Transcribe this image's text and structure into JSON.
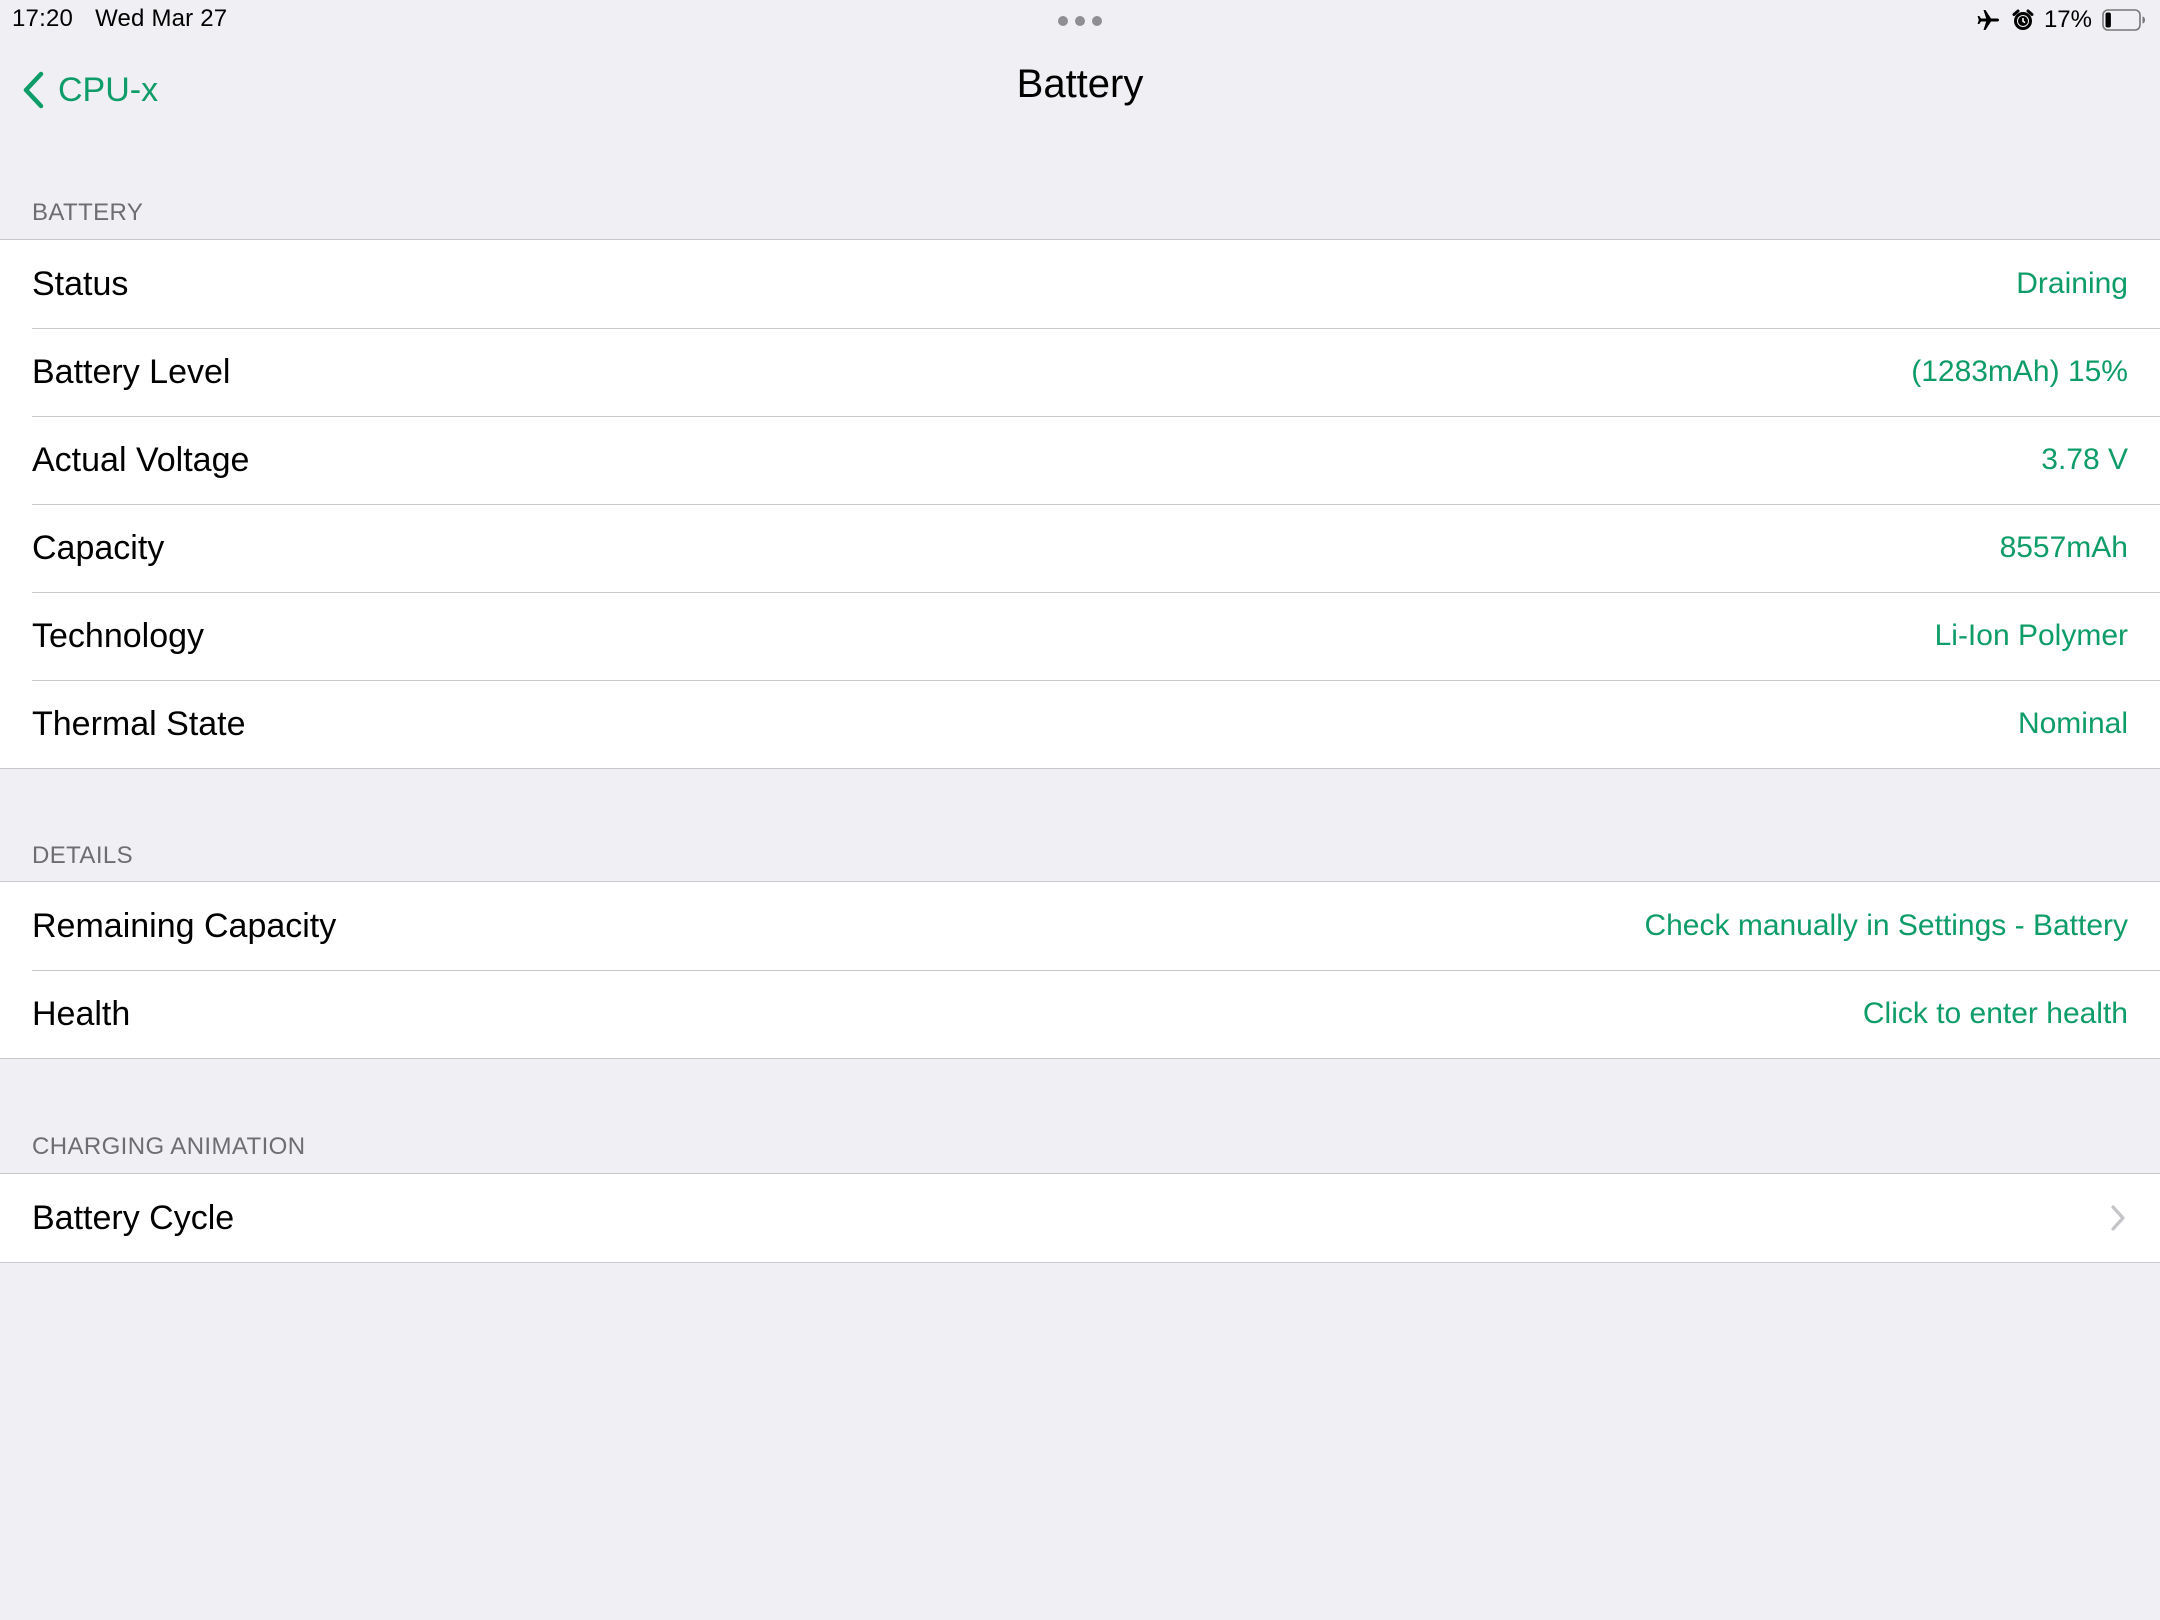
{
  "status_bar": {
    "time": "17:20",
    "date": "Wed Mar 27",
    "battery_percent": "17%",
    "battery_fill_fraction": 0.17,
    "icons": [
      "airplane-icon",
      "alarm-icon",
      "battery-icon"
    ]
  },
  "nav": {
    "back_label": "CPU-x",
    "title": "Battery"
  },
  "colors": {
    "accent": "#0e9c68",
    "background": "#efeff4",
    "separator": "#c8c7cc",
    "section_header": "#6d6d72"
  },
  "sections": [
    {
      "header": "BATTERY",
      "rows": [
        {
          "label": "Status",
          "value": "Draining"
        },
        {
          "label": "Battery Level",
          "value": "(1283mAh) 15%"
        },
        {
          "label": "Actual Voltage",
          "value": "3.78 V"
        },
        {
          "label": "Capacity",
          "value": "8557mAh"
        },
        {
          "label": "Technology",
          "value": "Li-Ion Polymer"
        },
        {
          "label": "Thermal State",
          "value": "Nominal"
        }
      ]
    },
    {
      "header": "DETAILS",
      "rows": [
        {
          "label": "Remaining Capacity",
          "value": "Check manually in Settings - Battery"
        },
        {
          "label": "Health",
          "value": "Click to enter health"
        }
      ]
    },
    {
      "header": "CHARGING ANIMATION",
      "rows": [
        {
          "label": "Battery Cycle",
          "icon": "chevron-right-icon"
        }
      ]
    }
  ]
}
